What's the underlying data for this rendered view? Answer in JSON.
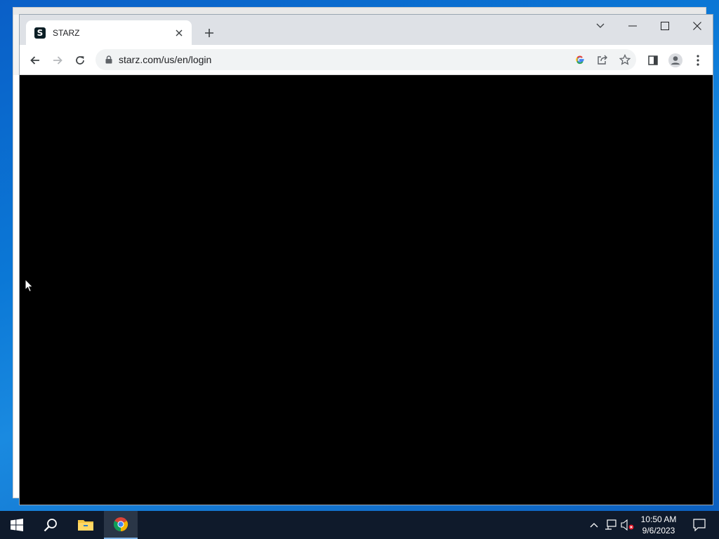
{
  "browser": {
    "tab": {
      "title": "STARZ",
      "favicon_letter": "S"
    },
    "url": "starz.com/us/en/login",
    "icons": {
      "back": "arrow-left-icon",
      "forward": "arrow-right-icon",
      "reload": "reload-icon",
      "lock": "lock-icon",
      "google": "google-icon",
      "share": "share-icon",
      "bookmark": "star-icon",
      "side_panel": "side-panel-icon",
      "profile": "profile-icon",
      "menu": "kebab-menu-icon"
    },
    "window_controls": [
      "tab-search",
      "minimize",
      "maximize",
      "close"
    ]
  },
  "taskbar": {
    "apps": [
      "start",
      "search",
      "file-explorer",
      "chrome"
    ],
    "clock": {
      "time": "10:50 AM",
      "date": "9/6/2023"
    }
  },
  "colors": {
    "titlebar": "#dee1e6",
    "content": "#000000",
    "taskbar": "#0f1a2b",
    "desktop": "#0b78d6"
  }
}
